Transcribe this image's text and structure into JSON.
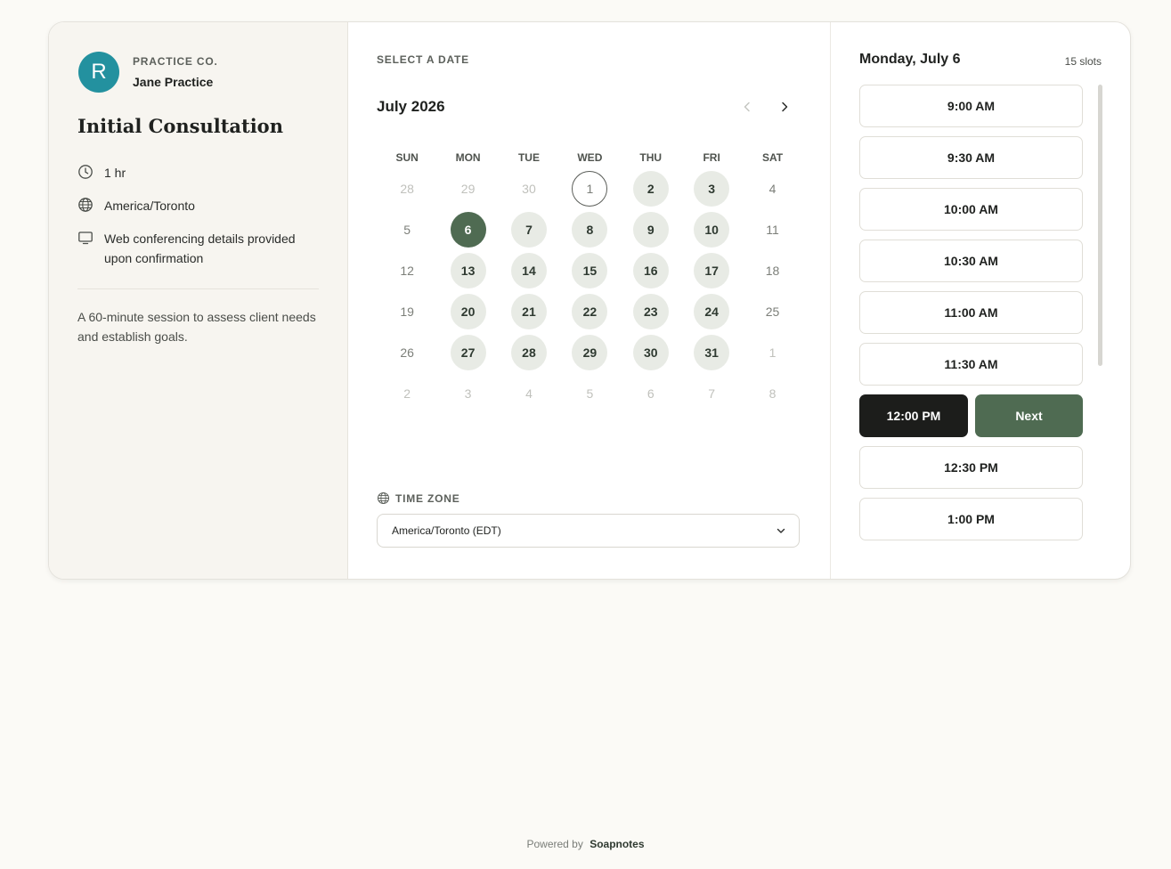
{
  "practice": {
    "avatar_letter": "R",
    "avatar_color": "#23919f",
    "org": "PRACTICE CO.",
    "host": "Jane Practice"
  },
  "event": {
    "title": "Initial Consultation",
    "duration": "1 hr",
    "timezone": "America/Toronto",
    "location": "Web conferencing details provided upon confirmation",
    "description": "A 60-minute session to assess client needs and establish goals."
  },
  "calendar": {
    "section_label": "SELECT A DATE",
    "month_label": "July 2026",
    "weekdays": [
      "SUN",
      "MON",
      "TUE",
      "WED",
      "THU",
      "FRI",
      "SAT"
    ],
    "weeks": [
      [
        {
          "d": "28",
          "s": "outside"
        },
        {
          "d": "29",
          "s": "outside"
        },
        {
          "d": "30",
          "s": "outside"
        },
        {
          "d": "1",
          "s": "today"
        },
        {
          "d": "2",
          "s": "avail"
        },
        {
          "d": "3",
          "s": "avail"
        },
        {
          "d": "4",
          "s": "na"
        }
      ],
      [
        {
          "d": "5",
          "s": "na"
        },
        {
          "d": "6",
          "s": "selected"
        },
        {
          "d": "7",
          "s": "avail"
        },
        {
          "d": "8",
          "s": "avail"
        },
        {
          "d": "9",
          "s": "avail"
        },
        {
          "d": "10",
          "s": "avail"
        },
        {
          "d": "11",
          "s": "na"
        }
      ],
      [
        {
          "d": "12",
          "s": "na"
        },
        {
          "d": "13",
          "s": "avail"
        },
        {
          "d": "14",
          "s": "avail"
        },
        {
          "d": "15",
          "s": "avail"
        },
        {
          "d": "16",
          "s": "avail"
        },
        {
          "d": "17",
          "s": "avail"
        },
        {
          "d": "18",
          "s": "na"
        }
      ],
      [
        {
          "d": "19",
          "s": "na"
        },
        {
          "d": "20",
          "s": "avail"
        },
        {
          "d": "21",
          "s": "avail"
        },
        {
          "d": "22",
          "s": "avail"
        },
        {
          "d": "23",
          "s": "avail"
        },
        {
          "d": "24",
          "s": "avail"
        },
        {
          "d": "25",
          "s": "na"
        }
      ],
      [
        {
          "d": "26",
          "s": "na"
        },
        {
          "d": "27",
          "s": "avail"
        },
        {
          "d": "28",
          "s": "avail"
        },
        {
          "d": "29",
          "s": "avail"
        },
        {
          "d": "30",
          "s": "avail"
        },
        {
          "d": "31",
          "s": "avail"
        },
        {
          "d": "1",
          "s": "outside"
        }
      ],
      [
        {
          "d": "2",
          "s": "outside"
        },
        {
          "d": "3",
          "s": "outside"
        },
        {
          "d": "4",
          "s": "outside"
        },
        {
          "d": "5",
          "s": "outside"
        },
        {
          "d": "6",
          "s": "outside"
        },
        {
          "d": "7",
          "s": "outside"
        },
        {
          "d": "8",
          "s": "outside"
        }
      ]
    ],
    "timezone_label": "TIME ZONE",
    "timezone_value": "America/Toronto (EDT)",
    "accent_color": "#4f6b52"
  },
  "slots": {
    "date_label": "Monday, July 6",
    "count_label": "15 slots",
    "times_before": [
      "9:00 AM",
      "9:30 AM",
      "10:00 AM",
      "10:30 AM",
      "11:00 AM",
      "11:30 AM"
    ],
    "selected_time": "12:00 PM",
    "next_label": "Next",
    "times_after": [
      "12:30 PM",
      "1:00 PM"
    ]
  },
  "footer": {
    "powered_by": "Powered by",
    "brand": "Soapnotes"
  }
}
